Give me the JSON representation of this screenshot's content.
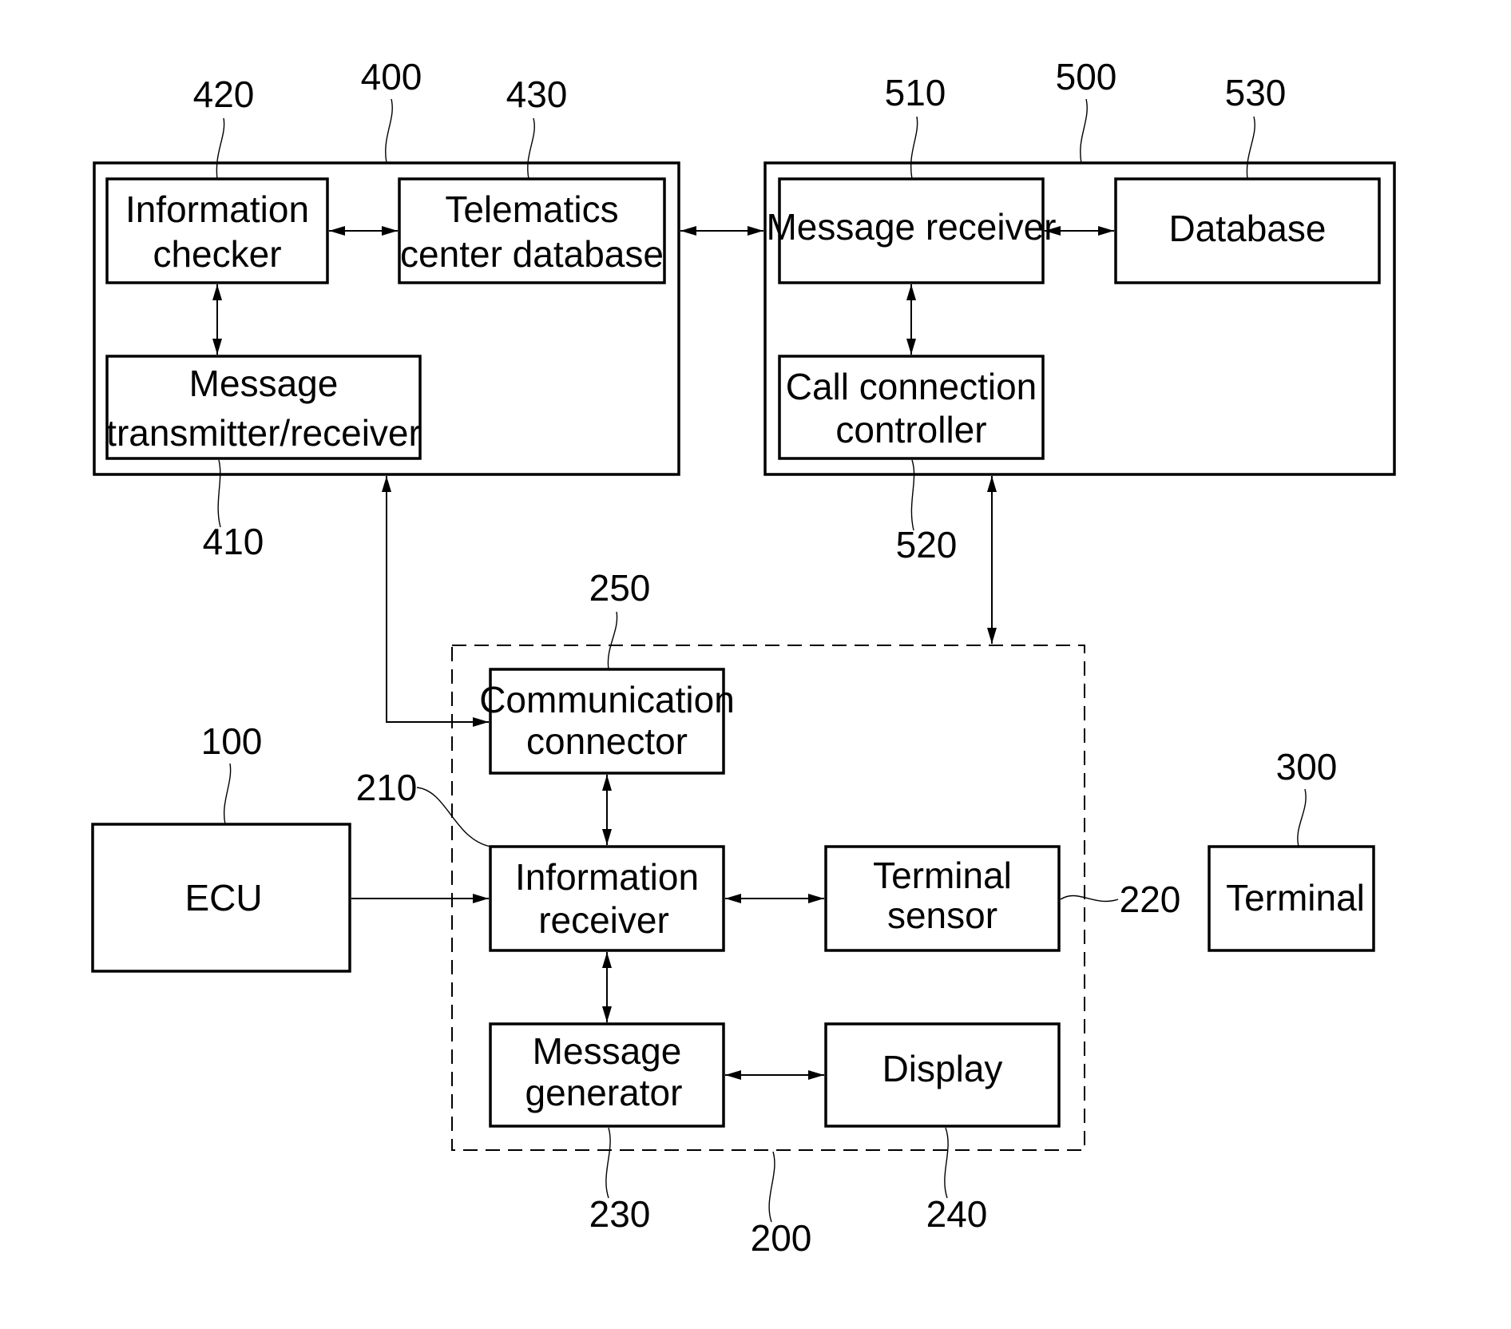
{
  "diagram": {
    "type": "block-diagram",
    "groups": {
      "telematics_center": {
        "ref": "400"
      },
      "call_center": {
        "ref": "500"
      },
      "vehicle_unit": {
        "ref": "200"
      }
    },
    "blocks": {
      "info_checker": {
        "ref": "420",
        "lines": [
          "Information",
          "checker"
        ]
      },
      "telematics_db": {
        "ref": "430",
        "lines": [
          "Telematics",
          "center database"
        ]
      },
      "msg_txrx": {
        "ref": "410",
        "lines": [
          "Message",
          "transmitter/receiver"
        ]
      },
      "msg_receiver": {
        "ref": "510",
        "lines": [
          "Message receiver"
        ]
      },
      "database": {
        "ref": "530",
        "lines": [
          "Database"
        ]
      },
      "call_ctrl": {
        "ref": "520",
        "lines": [
          "Call connection",
          "controller"
        ]
      },
      "comm_connector": {
        "ref": "250",
        "lines": [
          "Communication",
          "connector"
        ]
      },
      "ecu": {
        "ref": "100",
        "lines": [
          "ECU"
        ]
      },
      "info_receiver": {
        "ref": "210",
        "lines": [
          "Information",
          "receiver"
        ]
      },
      "terminal_sensor": {
        "ref": "220",
        "lines": [
          "Terminal",
          "sensor"
        ]
      },
      "msg_generator": {
        "ref": "230",
        "lines": [
          "Message",
          "generator"
        ]
      },
      "display": {
        "ref": "240",
        "lines": [
          "Display"
        ]
      },
      "terminal": {
        "ref": "300",
        "lines": [
          "Terminal"
        ]
      }
    },
    "connections": [
      {
        "from": "info_checker",
        "to": "telematics_db",
        "direction": "bidirectional"
      },
      {
        "from": "info_checker",
        "to": "msg_txrx",
        "direction": "bidirectional"
      },
      {
        "from": "telematics_center",
        "to": "call_center",
        "direction": "bidirectional"
      },
      {
        "from": "msg_receiver",
        "to": "database",
        "direction": "bidirectional"
      },
      {
        "from": "msg_receiver",
        "to": "call_ctrl",
        "direction": "bidirectional"
      },
      {
        "from": "comm_connector",
        "to": "telematics_center",
        "direction": "bidirectional"
      },
      {
        "from": "vehicle_unit",
        "to": "call_center",
        "direction": "bidirectional"
      },
      {
        "from": "comm_connector",
        "to": "info_receiver",
        "direction": "bidirectional"
      },
      {
        "from": "ecu",
        "to": "info_receiver",
        "direction": "forward"
      },
      {
        "from": "info_receiver",
        "to": "terminal_sensor",
        "direction": "bidirectional"
      },
      {
        "from": "info_receiver",
        "to": "msg_generator",
        "direction": "bidirectional"
      },
      {
        "from": "msg_generator",
        "to": "display",
        "direction": "bidirectional"
      }
    ]
  }
}
